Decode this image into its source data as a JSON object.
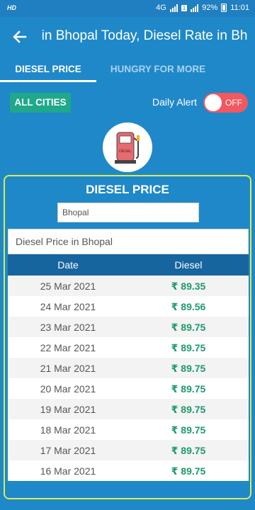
{
  "status_bar": {
    "hd": "HD",
    "network": "4G",
    "volte": "VoLTE",
    "sim": "1",
    "battery": "92%",
    "time": "11:01"
  },
  "app_bar": {
    "title": "Diesel Price in Bhopal Today, Diesel Rate in Bhopal"
  },
  "tabs": [
    {
      "label": "DIESEL PRICE",
      "selected": true
    },
    {
      "label": "HUNGRY FOR MORE",
      "selected": false
    }
  ],
  "controls": {
    "all_cities_label": "ALL CITIES",
    "daily_alert_label": "Daily Alert",
    "toggle_state": "OFF"
  },
  "pump": {
    "icon": "fuel-pump-icon",
    "label": "DIESEL"
  },
  "card": {
    "title": "DIESEL PRICE",
    "city_value": "Bhopal",
    "table_caption": "Diesel Price in Bhopal",
    "columns": [
      "Date",
      "Diesel"
    ],
    "rows": [
      {
        "date": "25 Mar 2021",
        "price": "₹ 89.35"
      },
      {
        "date": "24 Mar 2021",
        "price": "₹ 89.56"
      },
      {
        "date": "23 Mar 2021",
        "price": "₹ 89.75"
      },
      {
        "date": "22 Mar 2021",
        "price": "₹ 89.75"
      },
      {
        "date": "21 Mar 2021",
        "price": "₹ 89.75"
      },
      {
        "date": "20 Mar 2021",
        "price": "₹ 89.75"
      },
      {
        "date": "19 Mar 2021",
        "price": "₹ 89.75"
      },
      {
        "date": "18 Mar 2021",
        "price": "₹ 89.75"
      },
      {
        "date": "17 Mar 2021",
        "price": "₹ 89.75"
      },
      {
        "date": "16 Mar 2021",
        "price": "₹ 89.75"
      }
    ]
  },
  "colors": {
    "primary": "#1f88c9",
    "accent_green": "#1fa88a",
    "toggle_off": "#f2585f",
    "table_header": "#17659e",
    "card_border": "#d9ec52",
    "price_text": "#1e9a6a"
  }
}
